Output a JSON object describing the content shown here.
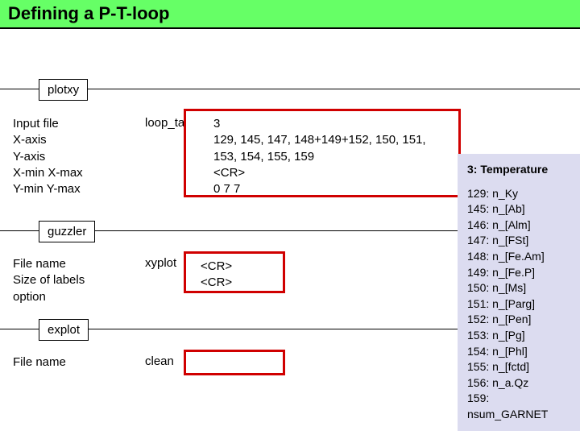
{
  "title": "Defining a P-T-loop",
  "sections": {
    "plotxy": {
      "tag": "plotxy",
      "left": [
        "Input file",
        "X-axis",
        "Y-axis",
        "X-min X-max",
        "Y-min Y-max"
      ],
      "cmd": "loop_table",
      "box": [
        "3",
        "129, 145, 147, 148+149+152, 150, 151, 153, 154, 155, 159",
        "<CR>",
        "0   7   7"
      ]
    },
    "guzzler": {
      "tag": "guzzler",
      "left": [
        "File name",
        "Size of labels",
        "option"
      ],
      "cmd": "xyplot",
      "box": [
        "<CR>",
        "<CR>"
      ]
    },
    "explot": {
      "tag": "explot",
      "left": [
        "File name"
      ],
      "cmd": "clean"
    }
  },
  "info": {
    "title": "3: Temperature",
    "lines": [
      "129: n_Ky",
      "145: n_[Ab]",
      "146: n_[Alm]",
      "147: n_[FSt]",
      "148: n_[Fe.Am]",
      "149: n_[Fe.P]",
      "150: n_[Ms]",
      "151: n_[Parg]",
      "152: n_[Pen]",
      "153: n_[Pg]",
      "154: n_[Phl]",
      "155: n_[fctd]",
      "156: n_a.Qz",
      "159: nsum_GARNET"
    ]
  }
}
